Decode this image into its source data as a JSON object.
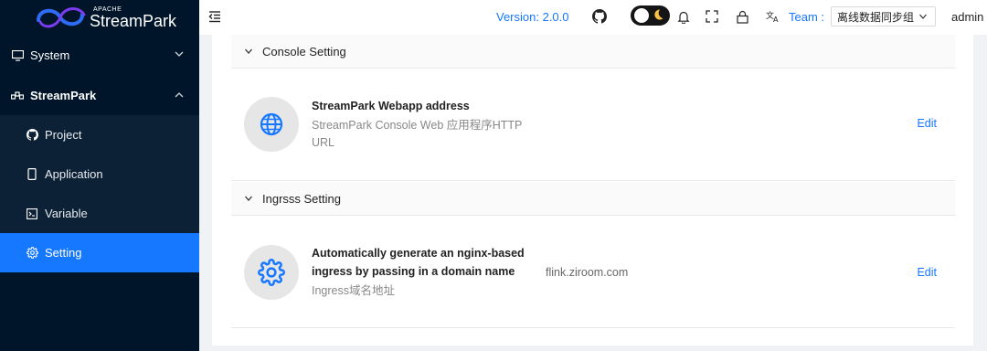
{
  "logo": {
    "apache": "APACHE",
    "brand": "StreamPark"
  },
  "sidebar": {
    "items": [
      {
        "label": "System"
      },
      {
        "label": "StreamPark"
      }
    ],
    "submenu": [
      {
        "label": "Project"
      },
      {
        "label": "Application"
      },
      {
        "label": "Variable"
      },
      {
        "label": "Setting"
      }
    ],
    "active": "Setting"
  },
  "header": {
    "version": "Version: 2.0.0",
    "team_label": "Team :",
    "team_value": "离线数据同步组",
    "user": "admin"
  },
  "sections": [
    {
      "title": "Console Setting",
      "row": {
        "title": "StreamPark Webapp address",
        "desc": "StreamPark Console Web 应用程序HTTP URL",
        "value": "",
        "action": "Edit",
        "icon": "globe-icon"
      }
    },
    {
      "title": "Ingrsss Setting",
      "row": {
        "title": "Automatically generate an nginx-based ingress by passing in a domain name",
        "desc": "Ingress域名地址",
        "value": "flink.ziroom.com",
        "action": "Edit",
        "icon": "gear-icon"
      }
    }
  ],
  "colors": {
    "sidebar_bg": "#001529",
    "accent": "#1677ff"
  }
}
